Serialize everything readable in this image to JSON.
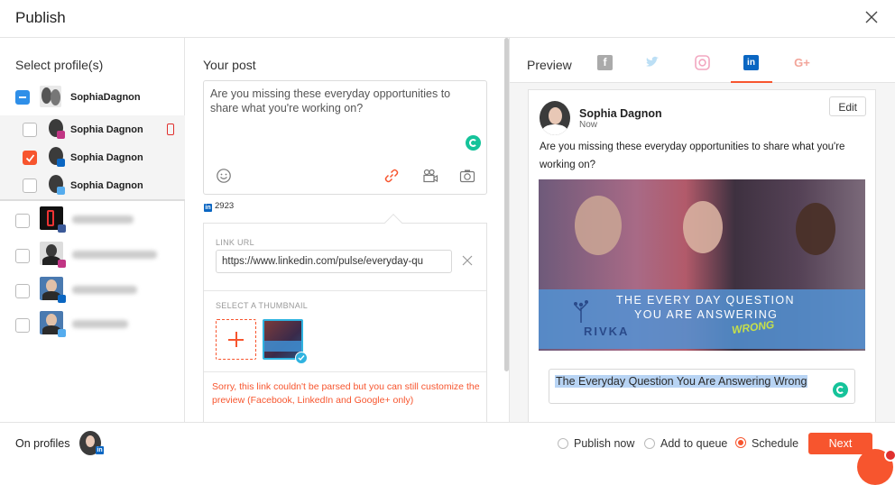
{
  "header": {
    "title": "Publish"
  },
  "profiles": {
    "label": "Select profile(s)",
    "group": {
      "name": "SophiaDagnon"
    },
    "sub_items": [
      {
        "name": "Sophia Dagnon",
        "network": "instagram",
        "checked": false
      },
      {
        "name": "Sophia Dagnon",
        "network": "linkedin",
        "checked": true
      },
      {
        "name": "Sophia Dagnon",
        "network": "twitter",
        "checked": false
      }
    ]
  },
  "post": {
    "label": "Your post",
    "text": "Are you missing these everyday opportunities to share what you're working on?",
    "char_count": "2923",
    "link_url_label": "LINK URL",
    "link_url_value": "https://www.linkedin.com/pulse/everyday-qu",
    "thumbnail_label": "SELECT A THUMBNAIL",
    "error": "Sorry, this link couldn't be parsed but you can still customize the preview (Facebook, LinkedIn and Google+ only)"
  },
  "preview": {
    "label": "Preview",
    "tabs": [
      {
        "icon": "facebook-icon",
        "active": false
      },
      {
        "icon": "twitter-icon",
        "active": false
      },
      {
        "icon": "instagram-icon",
        "active": false
      },
      {
        "icon": "linkedin-icon",
        "active": true
      },
      {
        "icon": "google-plus-icon",
        "active": false
      }
    ],
    "user_name": "Sophia Dagnon",
    "time": "Now",
    "edit_label": "Edit",
    "text": "Are you missing these everyday opportunities to share what you're working on?",
    "image_line1": "THE EVERY DAY QUESTION",
    "image_line2": "YOU ARE ANSWERING",
    "image_wrong": "WRONG",
    "image_brand": "RIVKA",
    "link_title": "The Everyday Question You Are Answering Wrong"
  },
  "footer": {
    "on_profiles": "On profiles",
    "options": [
      "Publish now",
      "Add to queue",
      "Schedule"
    ],
    "selected": "Schedule",
    "next_label": "Next"
  },
  "colors": {
    "accent": "#f7552e",
    "linkedin": "#0a66c2",
    "facebook": "#3b5998",
    "twitter": "#55acee",
    "select_blue": "#2f8fe8"
  }
}
